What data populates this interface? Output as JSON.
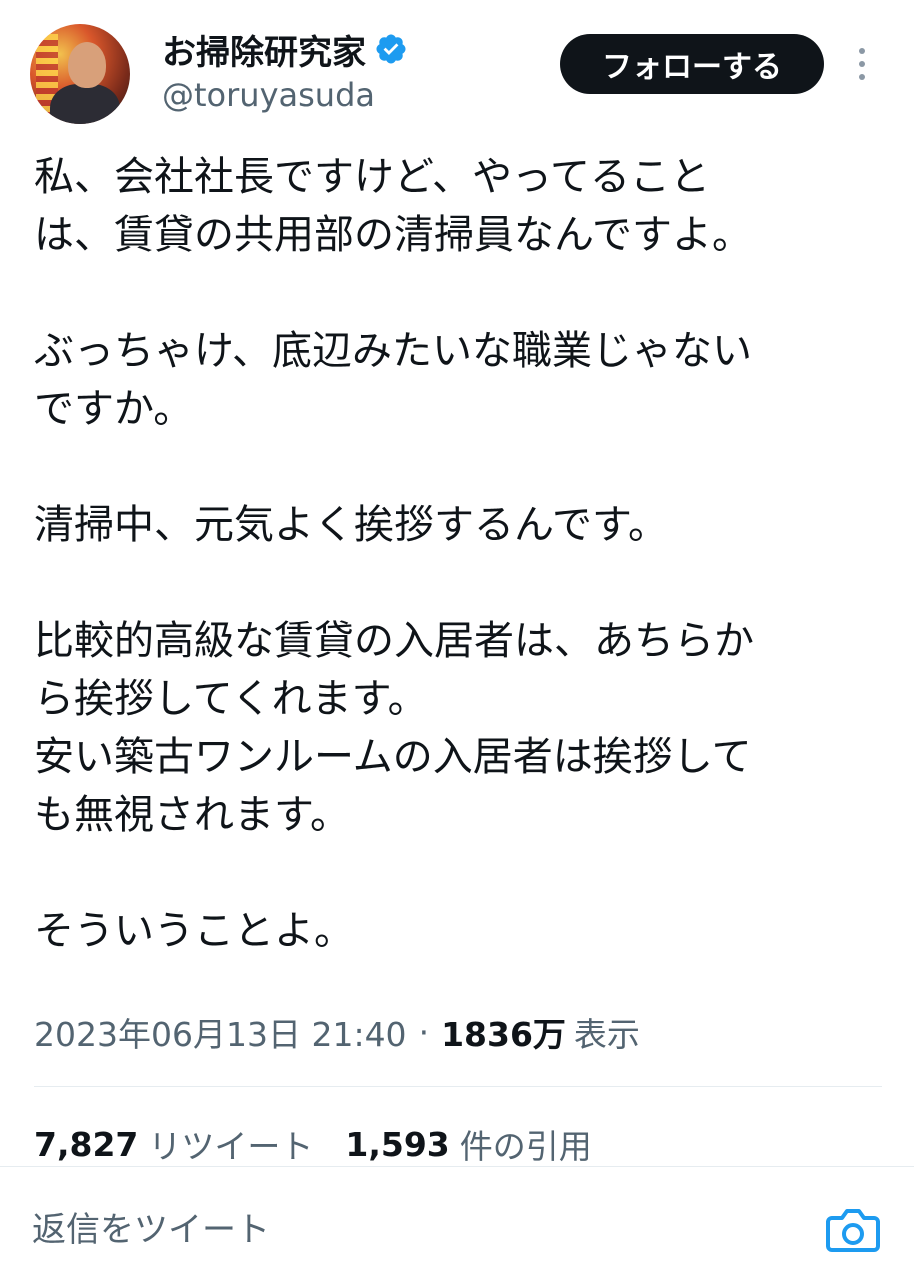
{
  "profile": {
    "display_name": "お掃除研究家",
    "handle": "@toruyasuda",
    "verified_color": "#1d9bf0",
    "follow_label": "フォローする"
  },
  "tweet": {
    "lines": [
      "私、会社社長ですけど、やってること",
      "は、賃貸の共用部の清掃員なんですよ。",
      "",
      "ぶっちゃけ、底辺みたいな職業じゃない",
      "ですか。",
      "",
      "清掃中、元気よく挨拶するんです。",
      "",
      "比較的高級な賃貸の入居者は、あちらか",
      "ら挨拶してくれます。",
      "安い築古ワンルームの入居者は挨拶して",
      "も無視されます。",
      "",
      "そういうことよ。"
    ]
  },
  "meta": {
    "timestamp": "2023年06月13日 21:40",
    "separator": "·",
    "views_count": "1836万",
    "views_label": "表示"
  },
  "stats": {
    "retweets_count": "7,827",
    "retweets_label": "リツイート",
    "quotes_count": "1,593",
    "quotes_label": "件の引用"
  },
  "reply": {
    "placeholder": "返信をツイート"
  },
  "icons": {
    "verified": "verified-badge-icon",
    "more": "more-vertical-icon",
    "camera": "camera-icon"
  }
}
